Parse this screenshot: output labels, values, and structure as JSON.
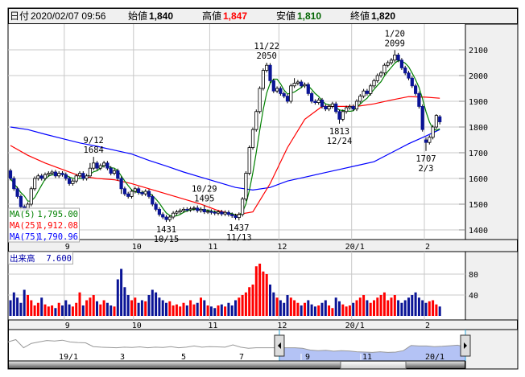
{
  "header": {
    "date_label": "日付",
    "date_value": "2020/02/07 09:56",
    "open_label": "始値",
    "open_value": "1,840",
    "high_label": "高値",
    "high_value": "1,847",
    "low_label": "安値",
    "low_value": "1,810",
    "close_label": "終値",
    "close_value": "1,820"
  },
  "legend": {
    "ma5_label": "MA(5)",
    "ma5_value": "1,795.00",
    "ma25_label": "MA(25)",
    "ma25_value": "1,912.08",
    "ma75_label": "MA(75)",
    "ma75_value": "1,790.96"
  },
  "volume": {
    "label": "出来高",
    "value": "7.600"
  },
  "colors": {
    "up_volume": "#ff0000",
    "down": "#0a1496",
    "ma5": "#008000",
    "ma25": "#ff0000",
    "ma75": "#0000ff",
    "nav_selection": "#b4c3f5"
  },
  "chart_data": {
    "type": "candlestick",
    "price_ticks": [
      "2100",
      "2000",
      "1900",
      "1800",
      "1700",
      "1600",
      "1500",
      "1400"
    ],
    "price_range": [
      1400,
      2100
    ],
    "volume_ticks": [
      "80",
      "40"
    ],
    "month_labels": [
      "9",
      "10",
      "11",
      "12",
      "20/1",
      "2"
    ],
    "month_start_index": [
      16,
      36,
      58,
      78,
      99,
      120
    ],
    "annotations": [
      {
        "index": 24,
        "top": "9/12",
        "bottom": "1684",
        "pos": "above",
        "price": 1684
      },
      {
        "index": 56,
        "top": "10/29",
        "bottom": "1495",
        "pos": "above",
        "price": 1495
      },
      {
        "index": 45,
        "top": "1431",
        "bottom": "10/15",
        "pos": "below",
        "price": 1431
      },
      {
        "index": 66,
        "top": "1437",
        "bottom": "11/13",
        "pos": "below",
        "price": 1437
      },
      {
        "index": 74,
        "top": "11/22",
        "bottom": "2050",
        "pos": "above",
        "price": 2050
      },
      {
        "index": 95,
        "top": "1813",
        "bottom": "12/24",
        "pos": "below",
        "price": 1813
      },
      {
        "index": 111,
        "top": "1/20",
        "bottom": "2099",
        "pos": "above",
        "price": 2099
      },
      {
        "index": 120,
        "top": "1707",
        "bottom": "2/3",
        "pos": "below",
        "price": 1707
      }
    ],
    "ohlc": [
      [
        1630,
        1638,
        1592,
        1600
      ],
      [
        1600,
        1608,
        1552,
        1560
      ],
      [
        1560,
        1568,
        1522,
        1530
      ],
      [
        1530,
        1538,
        1470,
        1490
      ],
      [
        1490,
        1498,
        1472,
        1480
      ],
      [
        1480,
        1508,
        1472,
        1500
      ],
      [
        1500,
        1568,
        1492,
        1560
      ],
      [
        1560,
        1608,
        1552,
        1600
      ],
      [
        1600,
        1618,
        1592,
        1610
      ],
      [
        1610,
        1618,
        1592,
        1600
      ],
      [
        1600,
        1623,
        1592,
        1615
      ],
      [
        1615,
        1628,
        1607,
        1620
      ],
      [
        1620,
        1633,
        1612,
        1625
      ],
      [
        1625,
        1633,
        1602,
        1610
      ],
      [
        1610,
        1628,
        1602,
        1620
      ],
      [
        1620,
        1628,
        1607,
        1615
      ],
      [
        1615,
        1623,
        1592,
        1600
      ],
      [
        1600,
        1608,
        1572,
        1580
      ],
      [
        1580,
        1598,
        1572,
        1590
      ],
      [
        1590,
        1618,
        1582,
        1610
      ],
      [
        1610,
        1628,
        1602,
        1620
      ],
      [
        1620,
        1628,
        1592,
        1600
      ],
      [
        1600,
        1618,
        1592,
        1610
      ],
      [
        1610,
        1660,
        1602,
        1640
      ],
      [
        1640,
        1684,
        1632,
        1660
      ],
      [
        1660,
        1668,
        1632,
        1640
      ],
      [
        1640,
        1658,
        1632,
        1650
      ],
      [
        1650,
        1668,
        1642,
        1660
      ],
      [
        1660,
        1668,
        1632,
        1640
      ],
      [
        1640,
        1648,
        1612,
        1620
      ],
      [
        1620,
        1638,
        1612,
        1630
      ],
      [
        1630,
        1638,
        1592,
        1600
      ],
      [
        1600,
        1608,
        1540,
        1560
      ],
      [
        1560,
        1568,
        1532,
        1540
      ],
      [
        1540,
        1548,
        1522,
        1530
      ],
      [
        1530,
        1558,
        1522,
        1550
      ],
      [
        1550,
        1568,
        1542,
        1560
      ],
      [
        1560,
        1568,
        1537,
        1545
      ],
      [
        1545,
        1553,
        1532,
        1540
      ],
      [
        1540,
        1558,
        1532,
        1550
      ],
      [
        1550,
        1558,
        1522,
        1530
      ],
      [
        1530,
        1538,
        1492,
        1500
      ],
      [
        1500,
        1508,
        1472,
        1480
      ],
      [
        1480,
        1488,
        1452,
        1460
      ],
      [
        1460,
        1468,
        1442,
        1450
      ],
      [
        1450,
        1458,
        1431,
        1440
      ],
      [
        1440,
        1458,
        1432,
        1450
      ],
      [
        1450,
        1473,
        1442,
        1465
      ],
      [
        1465,
        1478,
        1457,
        1470
      ],
      [
        1470,
        1483,
        1462,
        1475
      ],
      [
        1475,
        1488,
        1467,
        1480
      ],
      [
        1480,
        1488,
        1470,
        1478
      ],
      [
        1478,
        1490,
        1470,
        1482
      ],
      [
        1482,
        1493,
        1474,
        1485
      ],
      [
        1485,
        1495,
        1467,
        1475
      ],
      [
        1475,
        1488,
        1467,
        1480
      ],
      [
        1480,
        1495,
        1462,
        1470
      ],
      [
        1470,
        1480,
        1462,
        1472
      ],
      [
        1472,
        1480,
        1460,
        1468
      ],
      [
        1468,
        1476,
        1457,
        1465
      ],
      [
        1465,
        1478,
        1457,
        1470
      ],
      [
        1470,
        1478,
        1454,
        1462
      ],
      [
        1462,
        1476,
        1454,
        1468
      ],
      [
        1468,
        1476,
        1452,
        1460
      ],
      [
        1460,
        1468,
        1447,
        1455
      ],
      [
        1455,
        1463,
        1440,
        1448
      ],
      [
        1448,
        1468,
        1437,
        1460
      ],
      [
        1460,
        1528,
        1452,
        1520
      ],
      [
        1520,
        1628,
        1512,
        1620
      ],
      [
        1620,
        1728,
        1612,
        1720
      ],
      [
        1720,
        1798,
        1712,
        1790
      ],
      [
        1790,
        1868,
        1782,
        1860
      ],
      [
        1860,
        1958,
        1852,
        1950
      ],
      [
        1950,
        2028,
        1942,
        2020
      ],
      [
        2020,
        2050,
        2012,
        2040
      ],
      [
        2040,
        2048,
        1972,
        1980
      ],
      [
        1980,
        1988,
        1932,
        1940
      ],
      [
        1940,
        1958,
        1932,
        1950
      ],
      [
        1950,
        1958,
        1922,
        1930
      ],
      [
        1930,
        1938,
        1912,
        1920
      ],
      [
        1920,
        1928,
        1892,
        1900
      ],
      [
        1900,
        1968,
        1892,
        1960
      ],
      [
        1960,
        1990,
        1952,
        1970
      ],
      [
        1970,
        1983,
        1962,
        1975
      ],
      [
        1975,
        1983,
        1952,
        1960
      ],
      [
        1960,
        1973,
        1952,
        1965
      ],
      [
        1965,
        1973,
        1922,
        1930
      ],
      [
        1930,
        1938,
        1892,
        1900
      ],
      [
        1900,
        1908,
        1887,
        1895
      ],
      [
        1895,
        1913,
        1887,
        1905
      ],
      [
        1905,
        1913,
        1872,
        1880
      ],
      [
        1880,
        1888,
        1862,
        1870
      ],
      [
        1870,
        1888,
        1862,
        1880
      ],
      [
        1880,
        1898,
        1872,
        1890
      ],
      [
        1890,
        1898,
        1852,
        1860
      ],
      [
        1860,
        1868,
        1813,
        1830
      ],
      [
        1830,
        1868,
        1822,
        1860
      ],
      [
        1860,
        1883,
        1852,
        1875
      ],
      [
        1875,
        1888,
        1867,
        1880
      ],
      [
        1880,
        1888,
        1862,
        1870
      ],
      [
        1870,
        1908,
        1862,
        1900
      ],
      [
        1900,
        1928,
        1892,
        1920
      ],
      [
        1920,
        1948,
        1912,
        1940
      ],
      [
        1940,
        1948,
        1922,
        1930
      ],
      [
        1930,
        1968,
        1922,
        1960
      ],
      [
        1960,
        1988,
        1952,
        1980
      ],
      [
        1980,
        2008,
        1972,
        2000
      ],
      [
        2000,
        2018,
        1992,
        2010
      ],
      [
        2010,
        2048,
        2002,
        2040
      ],
      [
        2040,
        2058,
        2032,
        2050
      ],
      [
        2050,
        2068,
        2042,
        2060
      ],
      [
        2060,
        2099,
        2052,
        2080
      ],
      [
        2080,
        2088,
        2052,
        2060
      ],
      [
        2060,
        2068,
        2022,
        2030
      ],
      [
        2030,
        2038,
        2002,
        2010
      ],
      [
        2010,
        2018,
        1982,
        1990
      ],
      [
        1990,
        1998,
        1952,
        1960
      ],
      [
        1960,
        1968,
        1922,
        1930
      ],
      [
        1930,
        1938,
        1872,
        1880
      ],
      [
        1880,
        1888,
        1782,
        1790
      ],
      [
        1750,
        1760,
        1707,
        1740
      ],
      [
        1740,
        1768,
        1732,
        1760
      ],
      [
        1760,
        1808,
        1752,
        1800
      ],
      [
        1800,
        1850,
        1792,
        1845
      ],
      [
        1840,
        1847,
        1810,
        1820
      ]
    ],
    "volume": [
      30,
      45,
      35,
      25,
      50,
      40,
      30,
      20,
      25,
      35,
      22,
      18,
      20,
      15,
      25,
      20,
      30,
      22,
      18,
      25,
      45,
      20,
      30,
      35,
      40,
      28,
      22,
      30,
      25,
      20,
      18,
      70,
      90,
      55,
      40,
      30,
      35,
      25,
      30,
      28,
      40,
      50,
      45,
      35,
      30,
      25,
      28,
      20,
      22,
      18,
      25,
      20,
      30,
      22,
      25,
      35,
      30,
      20,
      18,
      15,
      20,
      22,
      18,
      25,
      20,
      30,
      35,
      40,
      45,
      55,
      60,
      95,
      100,
      85,
      80,
      60,
      45,
      35,
      30,
      25,
      40,
      35,
      30,
      25,
      20,
      25,
      30,
      22,
      18,
      20,
      25,
      30,
      20,
      15,
      35,
      28,
      22,
      18,
      20,
      25,
      30,
      35,
      40,
      30,
      25,
      30,
      35,
      40,
      45,
      30,
      35,
      40,
      30,
      25,
      30,
      35,
      40,
      45,
      35,
      30,
      25,
      28,
      30,
      22,
      18
    ],
    "ma25_points": [
      [
        0,
        1728
      ],
      [
        5,
        1690
      ],
      [
        10,
        1660
      ],
      [
        15,
        1635
      ],
      [
        20,
        1610
      ],
      [
        25,
        1600
      ],
      [
        30,
        1595
      ],
      [
        35,
        1580
      ],
      [
        40,
        1560
      ],
      [
        45,
        1540
      ],
      [
        50,
        1520
      ],
      [
        55,
        1500
      ],
      [
        60,
        1475
      ],
      [
        65,
        1458
      ],
      [
        70,
        1470
      ],
      [
        75,
        1580
      ],
      [
        80,
        1720
      ],
      [
        85,
        1830
      ],
      [
        90,
        1880
      ],
      [
        95,
        1880
      ],
      [
        100,
        1880
      ],
      [
        105,
        1890
      ],
      [
        110,
        1905
      ],
      [
        115,
        1918
      ],
      [
        120,
        1916
      ],
      [
        124,
        1912
      ]
    ],
    "ma75_points": [
      [
        0,
        1800
      ],
      [
        5,
        1790
      ],
      [
        10,
        1772
      ],
      [
        15,
        1755
      ],
      [
        20,
        1738
      ],
      [
        25,
        1725
      ],
      [
        30,
        1710
      ],
      [
        35,
        1695
      ],
      [
        40,
        1670
      ],
      [
        45,
        1648
      ],
      [
        50,
        1625
      ],
      [
        55,
        1605
      ],
      [
        60,
        1585
      ],
      [
        65,
        1565
      ],
      [
        70,
        1555
      ],
      [
        75,
        1565
      ],
      [
        80,
        1590
      ],
      [
        85,
        1605
      ],
      [
        90,
        1620
      ],
      [
        95,
        1635
      ],
      [
        100,
        1650
      ],
      [
        105,
        1665
      ],
      [
        110,
        1700
      ],
      [
        115,
        1735
      ],
      [
        120,
        1765
      ],
      [
        124,
        1790
      ]
    ],
    "navigator": {
      "labels": [
        "19/1",
        "3",
        "5",
        "7",
        "9",
        "11",
        "20/1"
      ],
      "prices": [
        1900,
        1980,
        1700,
        1850,
        1900,
        1950,
        1930,
        1960,
        1900,
        1880,
        1870,
        1740,
        1720,
        1710,
        1700,
        1720,
        1710,
        1730,
        1700,
        1720,
        1710,
        1740,
        1700,
        1720,
        1760,
        1720,
        1740,
        1730,
        1720,
        1800,
        1720,
        1680,
        1700,
        1700,
        1700,
        1700,
        1700,
        1700,
        1680,
        1620,
        1600,
        1610,
        1580,
        1600,
        1590,
        1560,
        1550,
        1540,
        1560,
        1540,
        1550,
        1600,
        1780,
        1760,
        1760,
        1740,
        1750,
        1770,
        1790,
        1720
      ],
      "selection_start_index": 35
    }
  }
}
